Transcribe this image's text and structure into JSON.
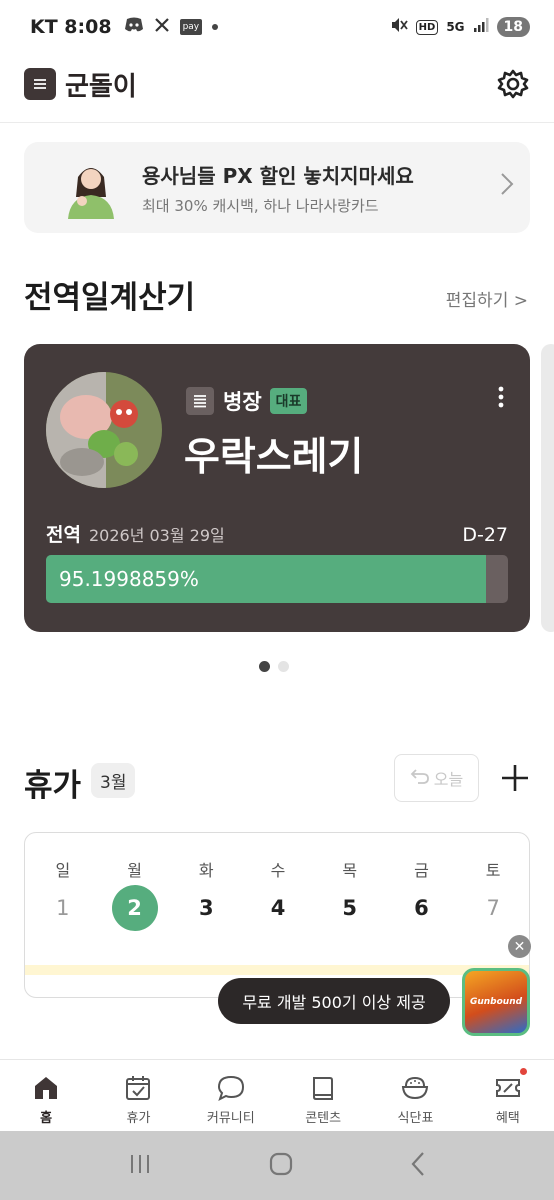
{
  "status_bar": {
    "carrier_time": "KT 8:08",
    "pay": "pay",
    "hd": "HD",
    "net": "5G",
    "battery": "18"
  },
  "header": {
    "title": "군돌이"
  },
  "promo": {
    "title": "용사님들 PX 할인 놓치지마세요",
    "subtitle": "최대 30% 캐시백, 하나 나라사랑카드"
  },
  "calculator": {
    "section_title": "전역일계산기",
    "edit_label": "편집하기 >",
    "card": {
      "rank": "병장",
      "badge": "대표",
      "name": "우락스레기",
      "discharge_label": "전역",
      "discharge_date": "2026년 03월 29일",
      "dday": "D-27",
      "progress_text": "95.1998859%",
      "progress_percent": 95.1998859
    },
    "pager": {
      "count": 2,
      "active": 0
    }
  },
  "vacation": {
    "section_title": "휴가",
    "month": "3월",
    "today_label": "오늘",
    "weekdays": [
      "일",
      "월",
      "화",
      "수",
      "목",
      "금",
      "토"
    ],
    "days": [
      "1",
      "2",
      "3",
      "4",
      "5",
      "6",
      "7"
    ],
    "selected_index": 1
  },
  "ad": {
    "tooltip": "무료 개발 500기 이상 제공",
    "game_name": "Gunbound"
  },
  "bottom_nav": {
    "items": [
      {
        "label": "홈",
        "icon": "home-icon"
      },
      {
        "label": "휴가",
        "icon": "calendar-check-icon"
      },
      {
        "label": "커뮤니티",
        "icon": "chat-bubble-icon"
      },
      {
        "label": "콘텐츠",
        "icon": "book-icon"
      },
      {
        "label": "식단표",
        "icon": "rice-bowl-icon"
      },
      {
        "label": "혜택",
        "icon": "ticket-icon"
      }
    ],
    "active_index": 0
  },
  "colors": {
    "brand_dark": "#3f3636",
    "accent_green": "#56ad7e",
    "card_bg": "#443b3b"
  }
}
